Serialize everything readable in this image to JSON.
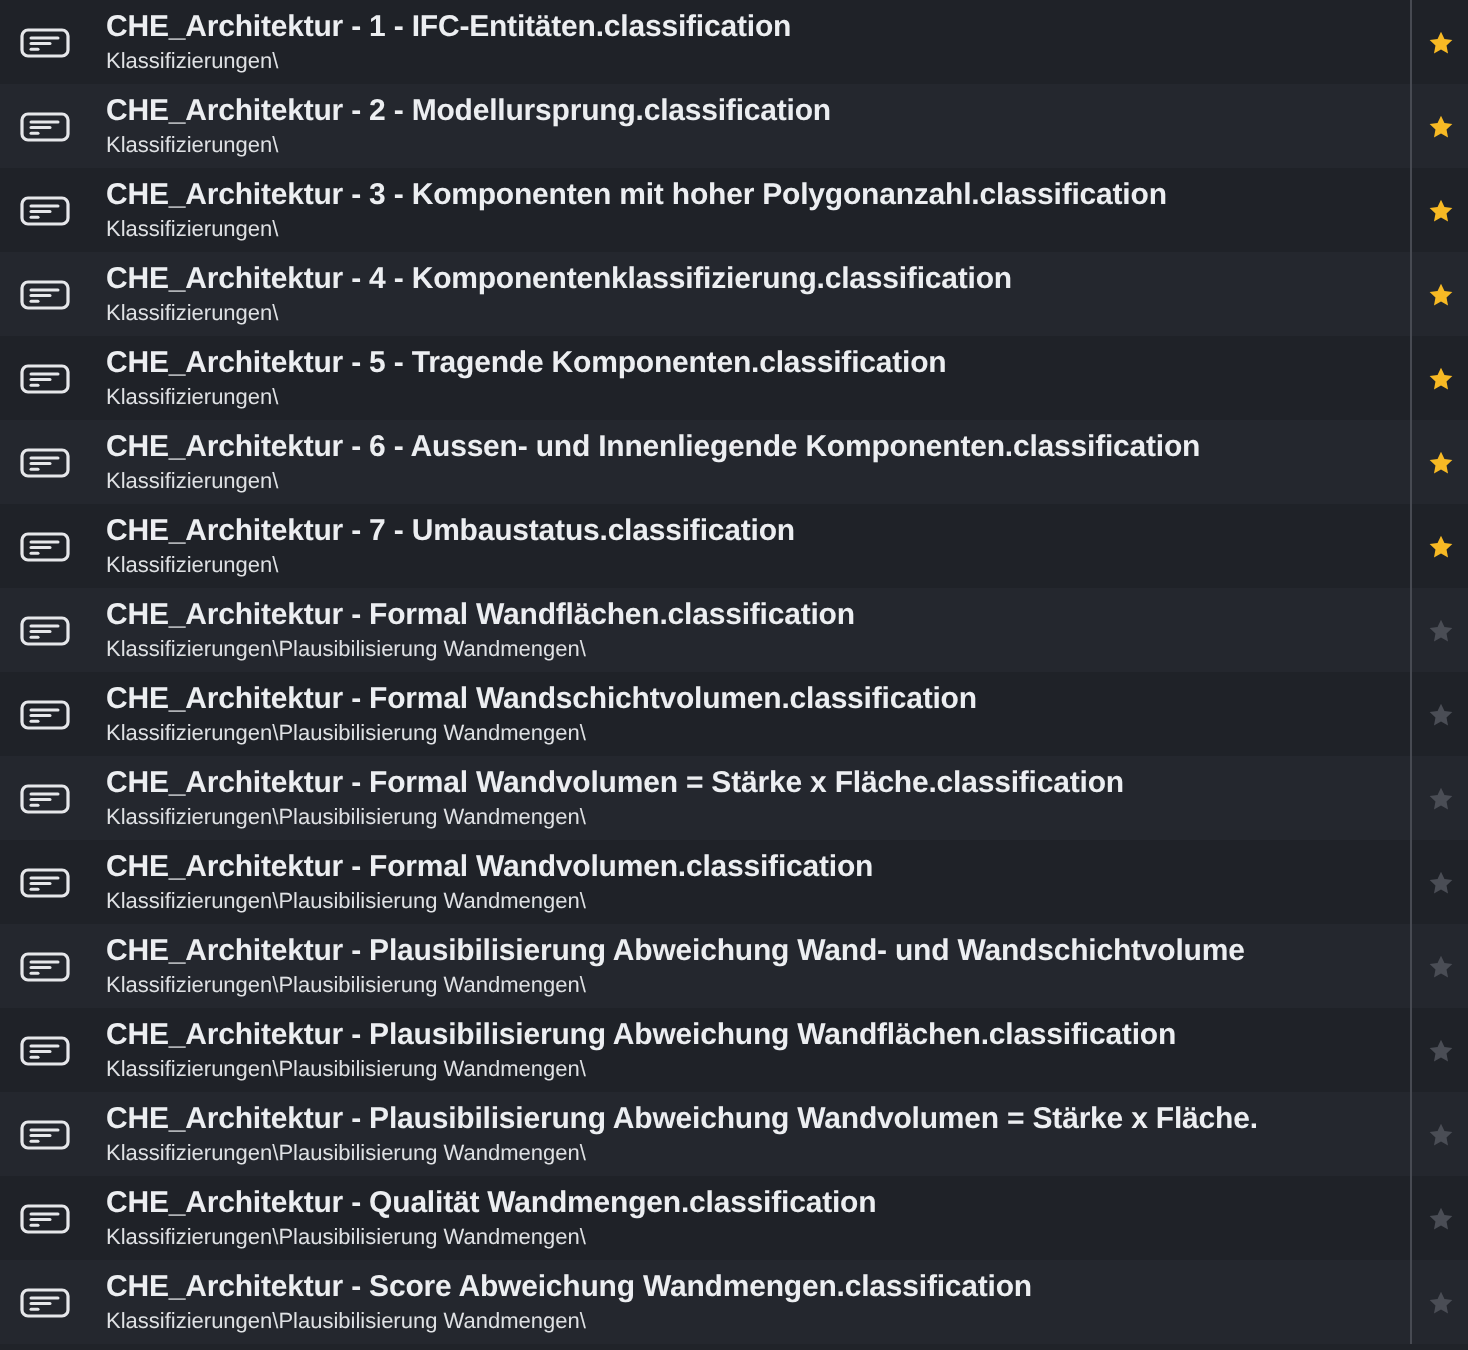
{
  "items": [
    {
      "title": "CHE_Architektur - 1 - IFC-Entitäten.classification",
      "path": "Klassifizierungen\\",
      "favorite": true
    },
    {
      "title": "CHE_Architektur - 2 - Modellursprung.classification",
      "path": "Klassifizierungen\\",
      "favorite": true
    },
    {
      "title": "CHE_Architektur - 3 - Komponenten mit hoher Polygonanzahl.classification",
      "path": "Klassifizierungen\\",
      "favorite": true
    },
    {
      "title": "CHE_Architektur - 4 - Komponentenklassifizierung.classification",
      "path": "Klassifizierungen\\",
      "favorite": true
    },
    {
      "title": "CHE_Architektur - 5 - Tragende Komponenten.classification",
      "path": "Klassifizierungen\\",
      "favorite": true
    },
    {
      "title": "CHE_Architektur - 6 - Aussen- und Innenliegende Komponenten.classification",
      "path": "Klassifizierungen\\",
      "favorite": true
    },
    {
      "title": "CHE_Architektur - 7 - Umbaustatus.classification",
      "path": "Klassifizierungen\\",
      "favorite": true
    },
    {
      "title": "CHE_Architektur - Formal Wandflächen.classification",
      "path": "Klassifizierungen\\Plausibilisierung Wandmengen\\",
      "favorite": false
    },
    {
      "title": "CHE_Architektur - Formal Wandschichtvolumen.classification",
      "path": "Klassifizierungen\\Plausibilisierung Wandmengen\\",
      "favorite": false
    },
    {
      "title": "CHE_Architektur - Formal Wandvolumen = Stärke x Fläche.classification",
      "path": "Klassifizierungen\\Plausibilisierung Wandmengen\\",
      "favorite": false
    },
    {
      "title": "CHE_Architektur - Formal Wandvolumen.classification",
      "path": "Klassifizierungen\\Plausibilisierung Wandmengen\\",
      "favorite": false
    },
    {
      "title": "CHE_Architektur - Plausibilisierung Abweichung Wand- und Wandschichtvolume",
      "path": "Klassifizierungen\\Plausibilisierung Wandmengen\\",
      "favorite": false
    },
    {
      "title": "CHE_Architektur - Plausibilisierung Abweichung Wandflächen.classification",
      "path": "Klassifizierungen\\Plausibilisierung Wandmengen\\",
      "favorite": false
    },
    {
      "title": "CHE_Architektur - Plausibilisierung Abweichung Wandvolumen = Stärke x Fläche.",
      "path": "Klassifizierungen\\Plausibilisierung Wandmengen\\",
      "favorite": false
    },
    {
      "title": "CHE_Architektur - Qualität Wandmengen.classification",
      "path": "Klassifizierungen\\Plausibilisierung Wandmengen\\",
      "favorite": false
    },
    {
      "title": "CHE_Architektur - Score Abweichung Wandmengen.classification",
      "path": "Klassifizierungen\\Plausibilisierung Wandmengen\\",
      "favorite": false
    }
  ]
}
